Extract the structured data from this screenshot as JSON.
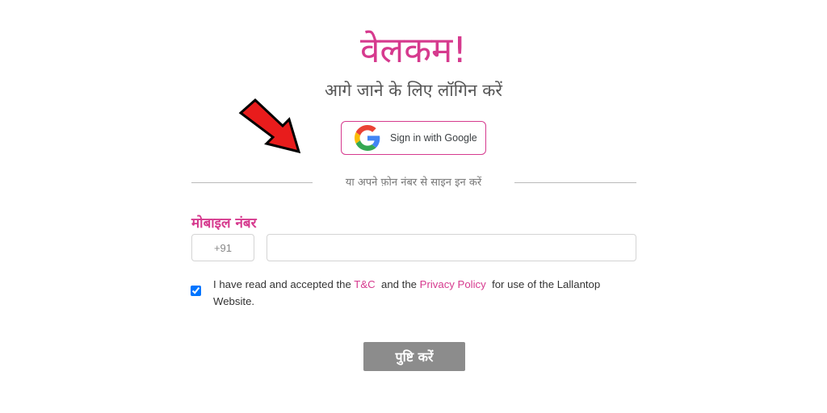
{
  "header": {
    "welcome": "वेलकम!",
    "subtitle": "आगे जाने के लिए लॉगिन करें"
  },
  "google_signin": {
    "label": "Sign in with Google",
    "icon": "google-g-icon"
  },
  "annotation": {
    "icon": "red-arrow-icon",
    "color": "#e81c1c"
  },
  "divider": {
    "text": "या अपने फ़ोन नंबर से साइन इन करें"
  },
  "mobile": {
    "label": "मोबाइल नंबर",
    "country_code": "+91",
    "value": "",
    "placeholder": ""
  },
  "terms": {
    "checked": true,
    "text_before": "I have read and accepted the",
    "tc_link": "T&C",
    "text_middle": "and the",
    "privacy_link": "Privacy Policy",
    "text_after": "for use of the Lallantop Website."
  },
  "confirm": {
    "label": "पुष्टि करें"
  },
  "colors": {
    "accent": "#d63a8e",
    "button_disabled": "#8c8c8c",
    "border": "#d4d4d4"
  }
}
